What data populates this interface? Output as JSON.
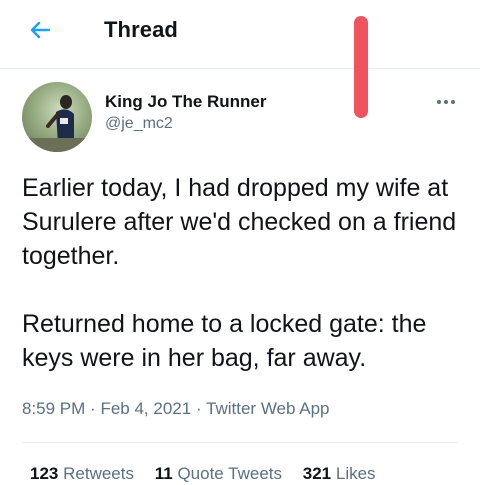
{
  "header": {
    "back_icon": "arrow-left-icon",
    "title": "Thread",
    "accent_color": "#1da1f2"
  },
  "tweet": {
    "author": {
      "name": "King Jo The Runner",
      "handle": "@je_mc2",
      "avatar_icon": "profile-photo"
    },
    "more_icon": "more-horizontal-icon",
    "paragraphs": [
      "Earlier today, I had dropped my wife at Surulere after we'd  checked on a friend together.",
      "Returned home to a locked gate: the keys were in her bag, far away."
    ],
    "time": "8:59 PM",
    "date": "Feb 4, 2021",
    "source": "Twitter Web App",
    "separator": "·"
  },
  "stats": {
    "retweets_count": "123",
    "retweets_label": "Retweets",
    "quotes_count": "11",
    "quotes_label": "Quote Tweets",
    "likes_count": "321",
    "likes_label": "Likes"
  }
}
